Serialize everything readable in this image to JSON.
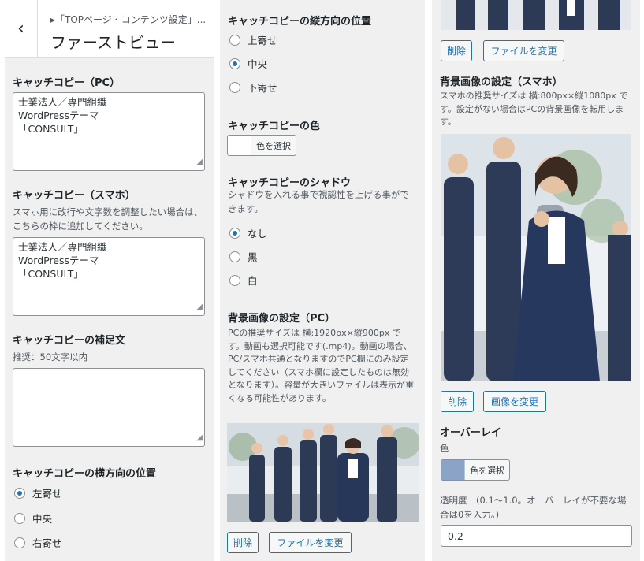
{
  "header": {
    "back_icon": "chevron-left-icon",
    "breadcrumb": "▸「TOPページ・コンテンツ設定」...",
    "title": "ファーストビュー"
  },
  "col1": {
    "catch_pc": {
      "label": "キャッチコピー（PC）",
      "lines": [
        "士業法人／専門組織",
        "WordPressテーマ",
        "「CONSULT」"
      ]
    },
    "catch_sp": {
      "label": "キャッチコピー（スマホ）",
      "desc": "スマホ用に改行や文字数を調整したい場合は、こちらの枠に追加してください。",
      "lines": [
        "士業法人／専門組織",
        "WordPressテーマ",
        "「CONSULT」"
      ]
    },
    "supplement": {
      "label": "キャッチコピーの補足文",
      "desc": "推奨：50文字以内",
      "value": ""
    },
    "h_position": {
      "label": "キャッチコピーの横方向の位置",
      "options": [
        "左寄せ",
        "中央",
        "右寄せ"
      ],
      "selected": 0
    }
  },
  "col2": {
    "v_position": {
      "label": "キャッチコピーの縦方向の位置",
      "options": [
        "上寄せ",
        "中央",
        "下寄せ"
      ],
      "selected": 1
    },
    "color": {
      "label": "キャッチコピーの色",
      "button": "色を選択",
      "swatch": "#ffffff"
    },
    "shadow": {
      "label": "キャッチコピーのシャドウ",
      "desc": "シャドウを入れる事で視認性を上げる事ができます。",
      "options": [
        "なし",
        "黒",
        "白"
      ],
      "selected": 0
    },
    "bg_pc": {
      "label": "背景画像の設定（PC）",
      "desc": "PCの推奨サイズは 横:1920px×縦900px です。動画も選択可能です(.mp4)。動画の場合、PC/スマホ共通となりますのでPC欄にのみ設定してください（スマホ欄に設定したものは無効となります）。容量が大きいファイルは表示が重くなる可能性があります。",
      "remove": "削除",
      "change": "ファイルを変更"
    }
  },
  "col3": {
    "top_buttons": {
      "remove": "削除",
      "change": "ファイルを変更"
    },
    "bg_sp": {
      "label": "背景画像の設定（スマホ）",
      "desc": "スマホの推奨サイズは 横:800px×縦1080px です。設定がない場合はPCの背景画像を転用します。",
      "remove": "削除",
      "change": "画像を変更"
    },
    "overlay": {
      "label": "オーバーレイ",
      "color_label": "色",
      "button": "色を選択",
      "swatch": "#8aa3c6",
      "opacity_label": "透明度　(0.1〜1.0。オーバーレイが不要な場合は0を入力。)",
      "opacity_value": "0.2"
    }
  }
}
